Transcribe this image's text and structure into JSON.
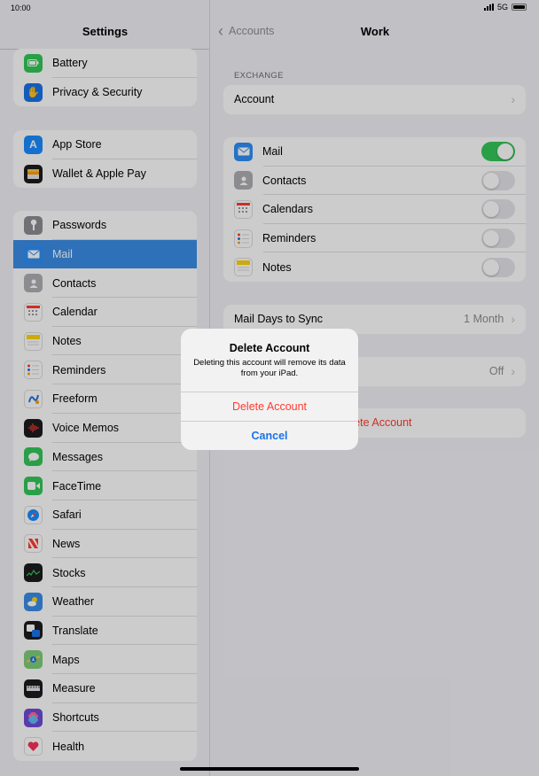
{
  "status_bar": {
    "time": "10:00",
    "network": "5G"
  },
  "sidebar": {
    "title": "Settings",
    "groups": [
      {
        "items": [
          {
            "label": "Battery",
            "icon": "battery-icon",
            "color": "#34c759"
          },
          {
            "label": "Privacy & Security",
            "icon": "hand-icon",
            "color": "#1a73e8"
          }
        ]
      },
      {
        "items": [
          {
            "label": "App Store",
            "icon": "app-store-icon",
            "color": "#1a8cff"
          },
          {
            "label": "Wallet & Apple Pay",
            "icon": "wallet-icon",
            "color": "#1c1c1e"
          }
        ]
      },
      {
        "items": [
          {
            "label": "Passwords",
            "icon": "key-icon",
            "color": "#8e8e93"
          },
          {
            "label": "Mail",
            "icon": "mail-icon",
            "color": "#2f8ff5",
            "selected": true
          },
          {
            "label": "Contacts",
            "icon": "contacts-icon",
            "color": "#b0b0b5"
          },
          {
            "label": "Calendar",
            "icon": "calendar-icon",
            "color": "#ffffff"
          },
          {
            "label": "Notes",
            "icon": "notes-icon",
            "color": "#ffd60a"
          },
          {
            "label": "Reminders",
            "icon": "reminders-icon",
            "color": "#ffffff"
          },
          {
            "label": "Freeform",
            "icon": "freeform-icon",
            "color": "#ffffff"
          },
          {
            "label": "Voice Memos",
            "icon": "voice-memos-icon",
            "color": "#1c1c1e"
          },
          {
            "label": "Messages",
            "icon": "messages-icon",
            "color": "#34c759"
          },
          {
            "label": "FaceTime",
            "icon": "facetime-icon",
            "color": "#34c759"
          },
          {
            "label": "Safari",
            "icon": "safari-icon",
            "color": "#ffffff"
          },
          {
            "label": "News",
            "icon": "news-icon",
            "color": "#ff3b30"
          },
          {
            "label": "Stocks",
            "icon": "stocks-icon",
            "color": "#1c1c1e"
          },
          {
            "label": "Weather",
            "icon": "weather-icon",
            "color": "#3a8ee6"
          },
          {
            "label": "Translate",
            "icon": "translate-icon",
            "color": "#1c1c1e"
          },
          {
            "label": "Maps",
            "icon": "maps-icon",
            "color": "#7ecf7a"
          },
          {
            "label": "Measure",
            "icon": "measure-icon",
            "color": "#1c1c1e"
          },
          {
            "label": "Shortcuts",
            "icon": "shortcuts-icon",
            "color": "#6e4bd8"
          },
          {
            "label": "Health",
            "icon": "health-icon",
            "color": "#ffffff"
          }
        ]
      }
    ]
  },
  "detail": {
    "back_label": "Accounts",
    "title": "Work",
    "section_header": "EXCHANGE",
    "account_row": "Account",
    "services": [
      {
        "label": "Mail",
        "icon": "mail-icon",
        "color": "#2f8ff5",
        "on": true
      },
      {
        "label": "Contacts",
        "icon": "contacts-icon",
        "color": "#b0b0b5",
        "on": false
      },
      {
        "label": "Calendars",
        "icon": "calendar-icon",
        "color": "#ffffff",
        "on": false
      },
      {
        "label": "Reminders",
        "icon": "reminders-icon",
        "color": "#ffffff",
        "on": false
      },
      {
        "label": "Notes",
        "icon": "notes-icon",
        "color": "#ffd60a",
        "on": false
      }
    ],
    "mail_days_label": "Mail Days to Sync",
    "mail_days_value": "1 Month",
    "auto_reply_value": "Off",
    "delete_row_label": "Delete Account"
  },
  "alert": {
    "title": "Delete Account",
    "message": "Deleting this account will remove its data from your iPad.",
    "destructive_label": "Delete Account",
    "cancel_label": "Cancel"
  }
}
